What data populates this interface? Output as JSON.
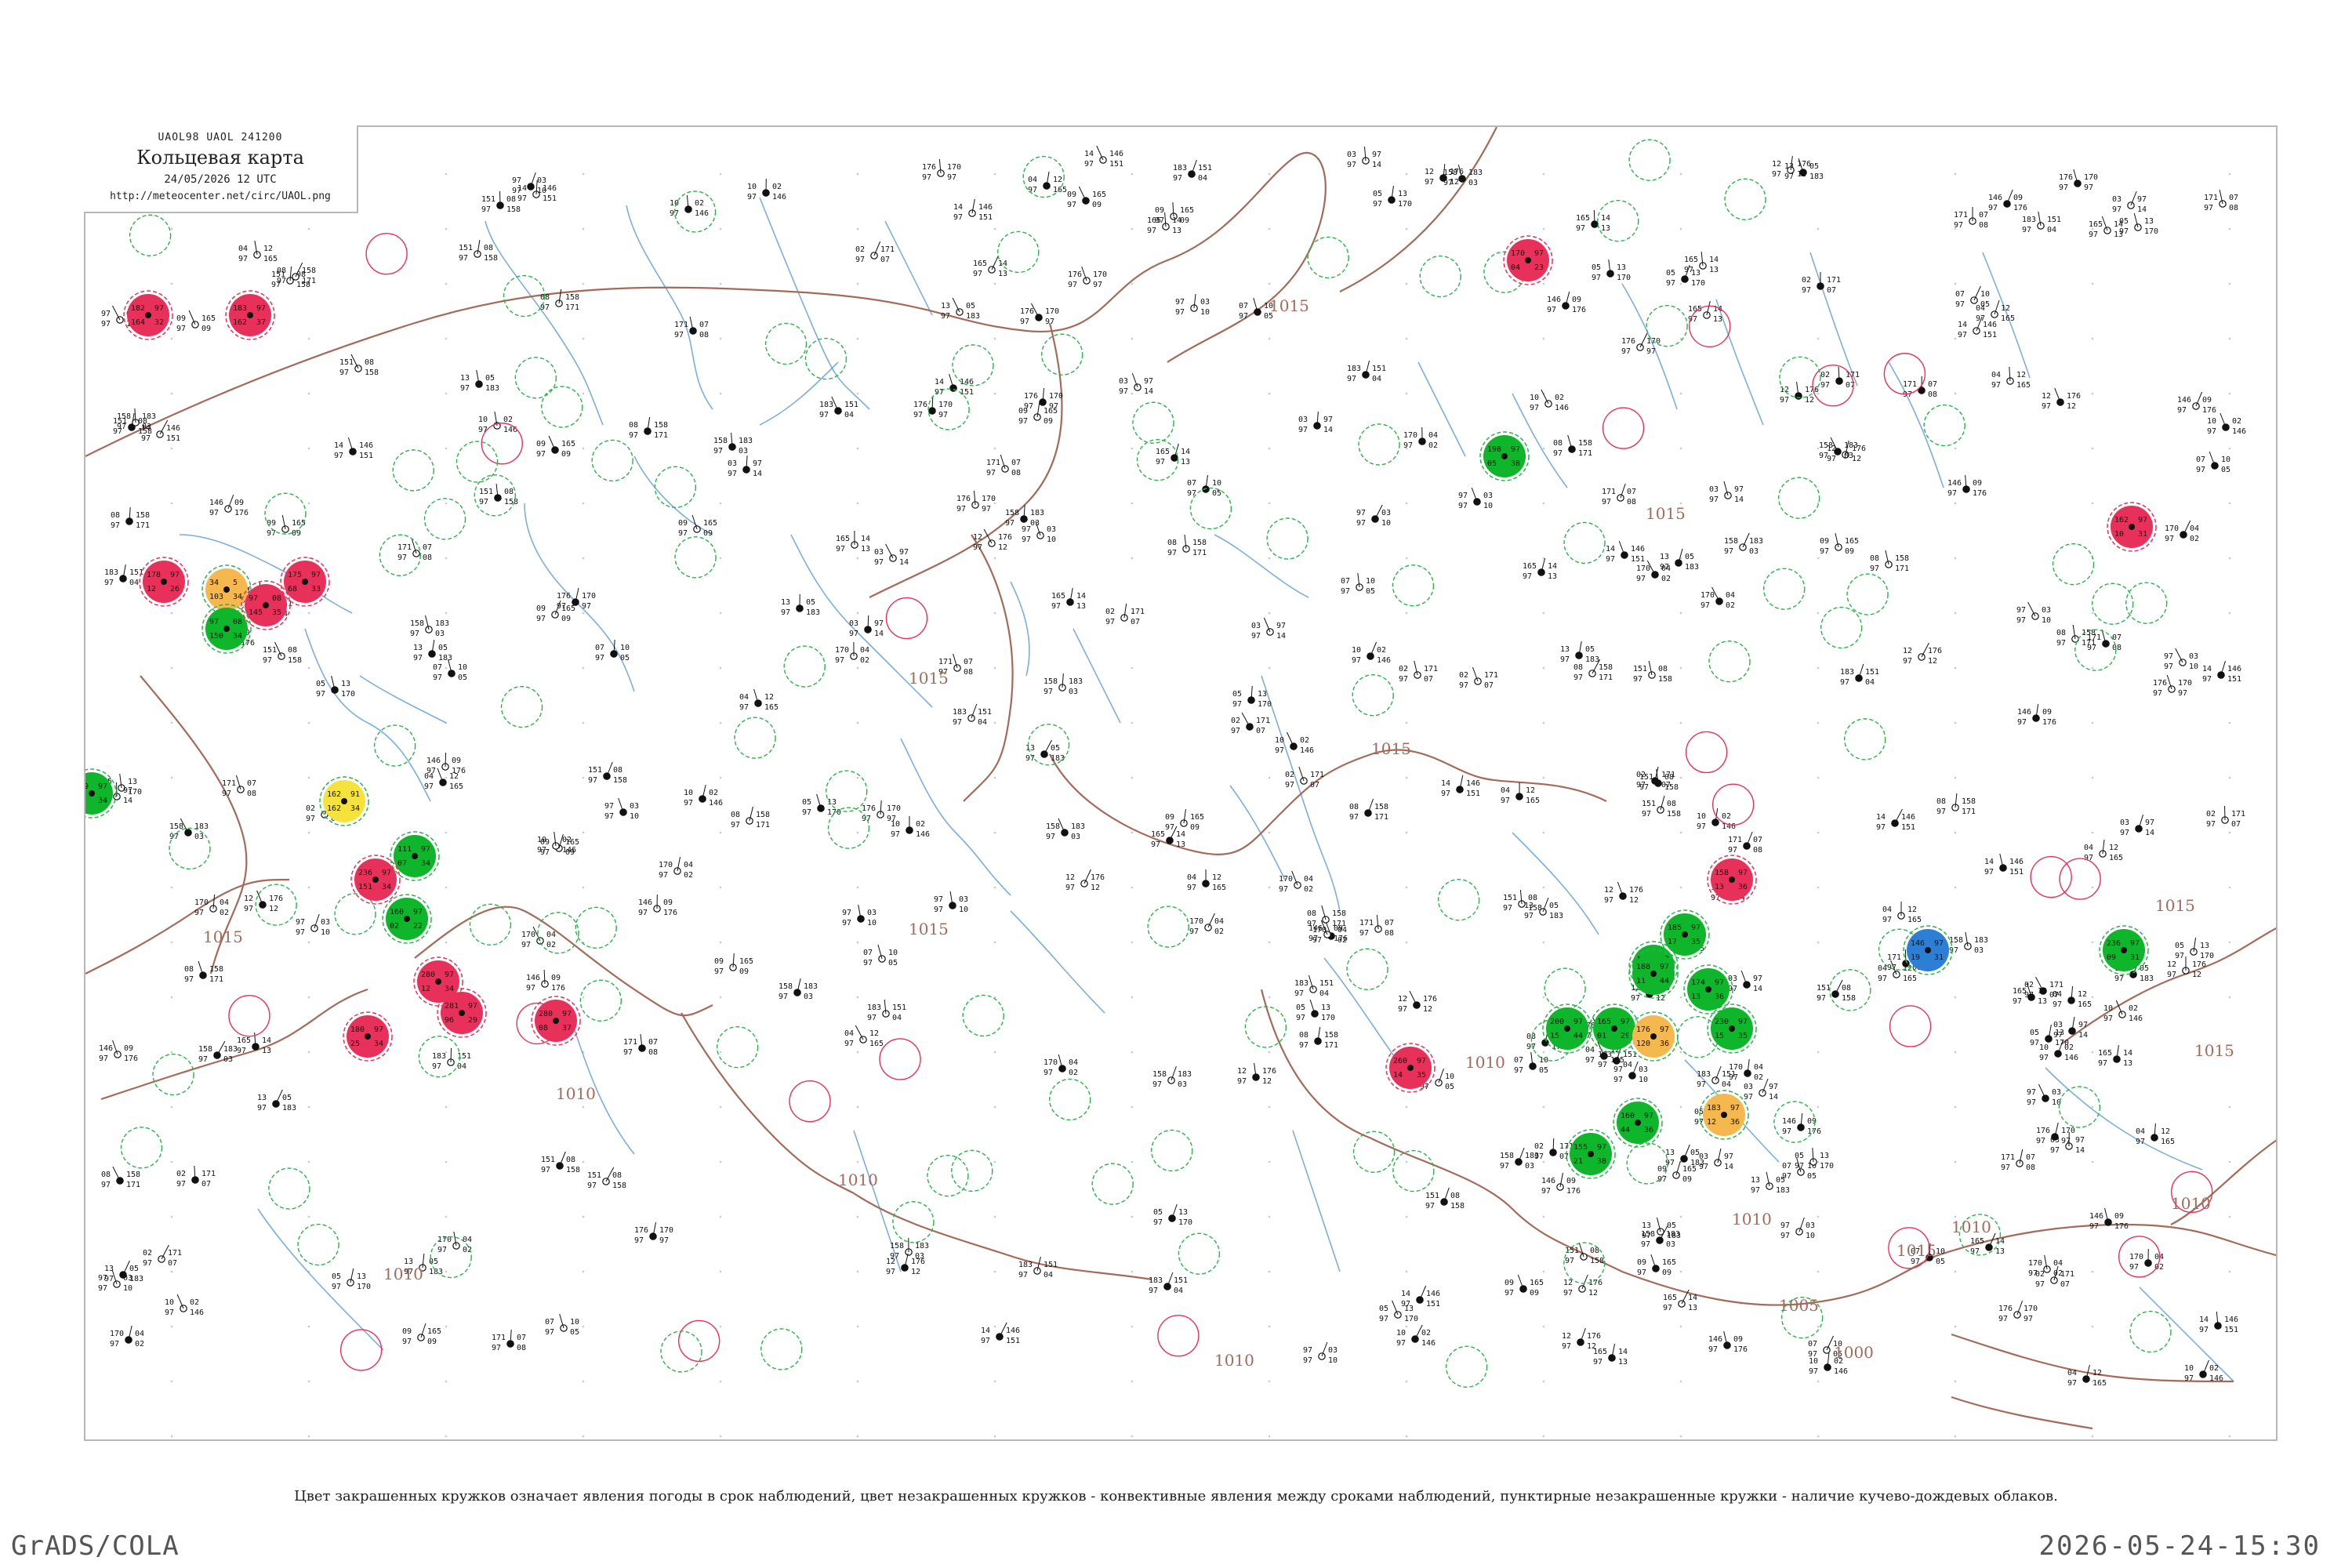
{
  "header": {
    "codes": "UAOL98  UAOL  241200",
    "title": "Кольцевая карта",
    "time": "24/05/2026 12 UTC",
    "url": "http://meteocenter.net/circ/UAOL.png"
  },
  "isobars": [
    "1015",
    "1015",
    "1015",
    "1015",
    "1015",
    "1015",
    "1015",
    "1015",
    "1015",
    "1010",
    "1010",
    "1010",
    "1010",
    "1010",
    "1010",
    "1010",
    "1010",
    "1005",
    "1000"
  ],
  "colors": {
    "isobar": "#a46a5a",
    "river": "#5b9bd5",
    "storm": "#e8315a",
    "rain": "#0fb52a",
    "dust": "#f5b84e",
    "haze": "#f5e23c",
    "snow": "#2d7fd6",
    "dashed_ring": "#2bb34a"
  },
  "stations": {
    "filled": [
      {
        "id": "32",
        "wx": "storm",
        "values": [
          "182",
          "97",
          "164"
        ]
      },
      {
        "id": "37",
        "wx": "storm",
        "values": [
          "183",
          "97",
          "162"
        ]
      },
      {
        "id": "26",
        "wx": "storm",
        "values": [
          "178",
          "97",
          "12"
        ]
      },
      {
        "id": "33",
        "wx": "storm",
        "values": [
          "175",
          "97",
          "68"
        ]
      },
      {
        "id": "34",
        "wx": "dust",
        "values": [
          "34",
          "5",
          "103"
        ]
      },
      {
        "id": "34",
        "wx": "rain",
        "values": [
          "97",
          "08",
          "150"
        ]
      },
      {
        "id": "35",
        "wx": "storm",
        "values": [
          "97",
          "08",
          "145"
        ]
      },
      {
        "id": "34",
        "wx": "haze",
        "values": [
          "162",
          "91",
          "162"
        ]
      },
      {
        "id": "34",
        "wx": "rain",
        "values": [
          "179",
          "97",
          "09"
        ]
      },
      {
        "id": "34",
        "wx": "rain",
        "values": [
          "111",
          "97",
          "07"
        ]
      },
      {
        "id": "34",
        "wx": "storm",
        "values": [
          "236",
          "97",
          "151"
        ]
      },
      {
        "id": "22",
        "wx": "rain",
        "values": [
          "160",
          "97",
          "02"
        ]
      },
      {
        "id": "34",
        "wx": "storm",
        "values": [
          "280",
          "97",
          "12"
        ]
      },
      {
        "id": "34",
        "wx": "storm",
        "values": [
          "180",
          "97",
          "25"
        ]
      },
      {
        "id": "29",
        "wx": "storm",
        "values": [
          "281",
          "97",
          "96"
        ]
      },
      {
        "id": "37",
        "wx": "storm",
        "values": [
          "280",
          "97",
          "08"
        ]
      },
      {
        "id": "23",
        "wx": "storm",
        "values": [
          "170",
          "97",
          "04"
        ]
      },
      {
        "id": "38",
        "wx": "rain",
        "values": [
          "198",
          "97",
          "05"
        ]
      },
      {
        "id": "35",
        "wx": "storm",
        "values": [
          "260",
          "97",
          "14"
        ]
      },
      {
        "id": "29",
        "wx": "rain",
        "values": [
          "165",
          "97",
          "01"
        ]
      },
      {
        "id": "44",
        "wx": "rain",
        "values": [
          "145",
          "97",
          "03"
        ]
      },
      {
        "id": "44",
        "wx": "rain",
        "values": [
          "200",
          "97",
          "15"
        ]
      },
      {
        "id": "36",
        "wx": "storm",
        "values": [
          "158",
          "97",
          "13"
        ]
      },
      {
        "id": "35",
        "wx": "rain",
        "values": [
          "185",
          "97",
          "17"
        ]
      },
      {
        "id": "36",
        "wx": "dust",
        "values": [
          "176",
          "97",
          "120"
        ]
      },
      {
        "id": "36",
        "wx": "rain",
        "values": [
          "160",
          "97",
          "44"
        ]
      },
      {
        "id": "38",
        "wx": "rain",
        "values": [
          "155",
          "97",
          "21"
        ]
      },
      {
        "id": "44",
        "wx": "rain",
        "values": [
          "188",
          "97",
          "11"
        ]
      },
      {
        "id": "36",
        "wx": "rain",
        "values": [
          "174",
          "97",
          "13"
        ]
      },
      {
        "id": "35",
        "wx": "rain",
        "values": [
          "230",
          "97",
          "15"
        ]
      },
      {
        "id": "36",
        "wx": "dust",
        "values": [
          "183",
          "97",
          "12"
        ]
      },
      {
        "id": "31",
        "wx": "snow",
        "values": [
          "146",
          "97",
          "19"
        ]
      },
      {
        "id": "31",
        "wx": "rain",
        "values": [
          "236",
          "97",
          "09"
        ]
      },
      {
        "id": "31",
        "wx": "storm",
        "values": [
          "162",
          "97",
          "10"
        ]
      }
    ]
  },
  "caption": "Цвет закрашенных кружков означает явления погоды в срок наблюдений, цвет незакрашенных кружков - конвективные явления между сроками наблюдений, пунктирные незакрашенные кружки - наличие кучево-дождевых облаков.",
  "footer": {
    "brand": "GrADS/COLA",
    "timestamp": "2026-05-24-15:30"
  }
}
